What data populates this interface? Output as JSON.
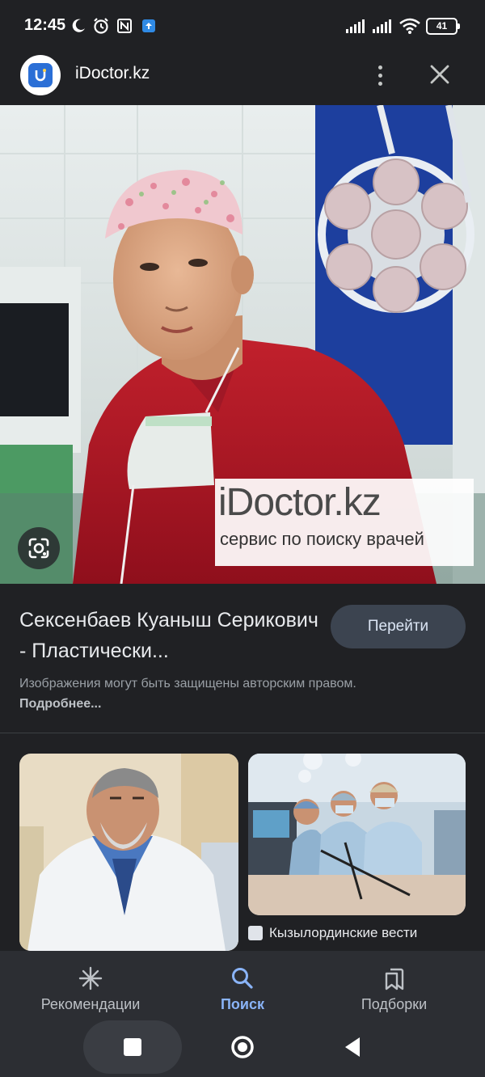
{
  "status_bar": {
    "time": "12:45",
    "battery": "41",
    "icons": [
      "moon-icon",
      "alarm-icon",
      "nfc-icon",
      "upload-notification-icon",
      "signal-icon",
      "signal-icon",
      "wifi-icon",
      "battery-icon"
    ]
  },
  "header": {
    "site_name": "iDoctor.kz",
    "menu_icon": "more-vertical-icon",
    "close_icon": "close-icon"
  },
  "hero": {
    "watermark_brand": "iDoctor.kz",
    "watermark_tagline": "сервис по поиску врачей",
    "lens_icon": "google-lens-icon"
  },
  "result": {
    "title": "Сексенбаев Куаныш Серикович - Пластически...",
    "visit_label": "Перейти",
    "copyright_text": "Изображения могут быть защищены авторским правом.",
    "more_link": "Подробнее..."
  },
  "related": [
    {
      "source": ""
    },
    {
      "source": "Кызылординские вести"
    }
  ],
  "bottom_nav": {
    "items": [
      {
        "label": "Рекомендации",
        "icon": "asterisk-icon",
        "active": false
      },
      {
        "label": "Поиск",
        "icon": "search-icon",
        "active": true
      },
      {
        "label": "Подборки",
        "icon": "collections-icon",
        "active": false
      }
    ]
  },
  "colors": {
    "background": "#202124",
    "accent": "#8ab4f8",
    "button_bg": "#3c4450",
    "nav_bg": "#2c2e33"
  }
}
